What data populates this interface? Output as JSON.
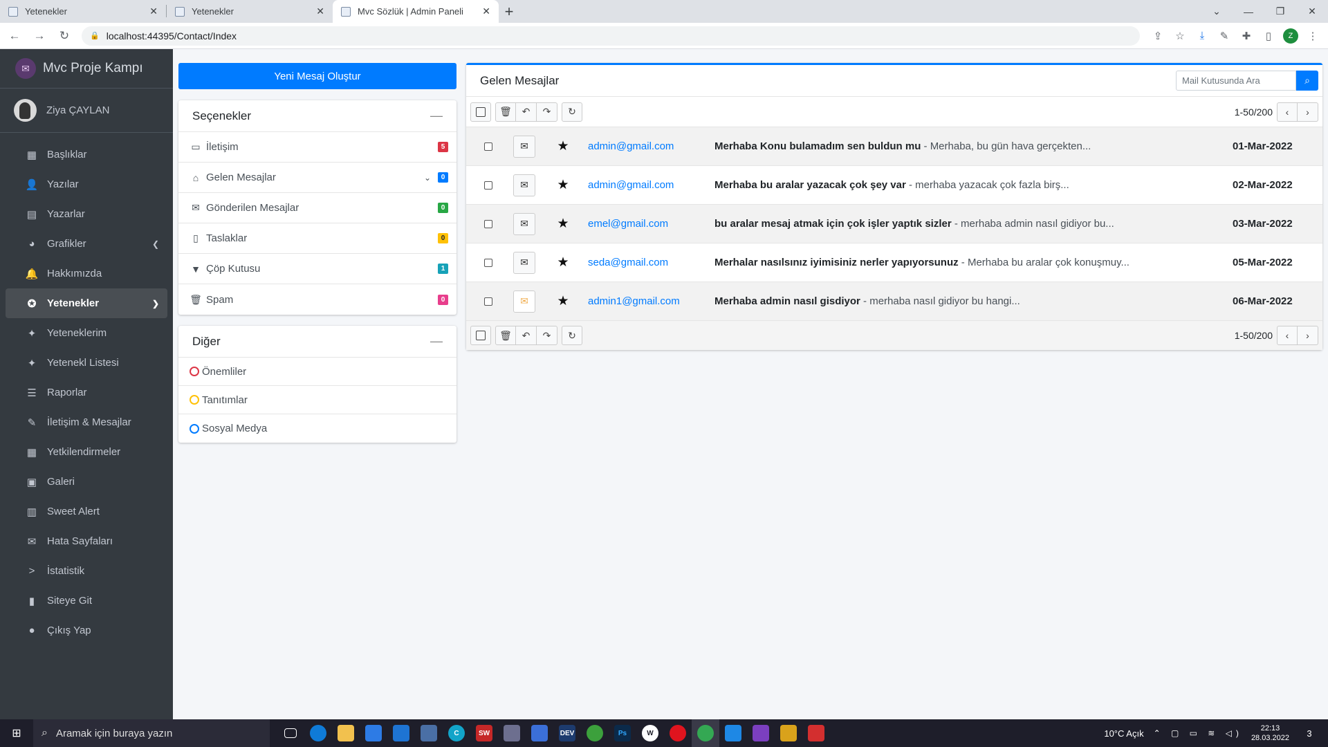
{
  "browser": {
    "tabs": [
      {
        "title": "Yetenekler",
        "active": false
      },
      {
        "title": "Yetenekler",
        "active": false
      },
      {
        "title": "Mvc Sözlük | Admin Paneli",
        "active": true
      }
    ],
    "url": "localhost:44395/Contact/Index",
    "profile_initial": "Z"
  },
  "sidebar": {
    "brand": "Mvc Proje Kampı",
    "user": "Ziya ÇAYLAN",
    "items": [
      {
        "label": "Başlıklar",
        "icon": "th-icon"
      },
      {
        "label": "Yazılar",
        "icon": "user-tie-icon"
      },
      {
        "label": "Yazarlar",
        "icon": "book-icon"
      },
      {
        "label": "Grafikler",
        "icon": "chart-pie-icon"
      },
      {
        "label": "Hakkımızda",
        "icon": "bell-icon"
      },
      {
        "label": "Yetenekler",
        "icon": "award-icon"
      },
      {
        "label": "Yeteneklerim",
        "icon": "puzzle-icon"
      },
      {
        "label": "Yetenekl Listesi",
        "icon": "puzzle-icon"
      },
      {
        "label": "Raporlar",
        "icon": "bars-icon"
      },
      {
        "label": "İletişim & Mesajlar",
        "icon": "edit-icon"
      },
      {
        "label": "Yetkilendirmeler",
        "icon": "calendar-icon"
      },
      {
        "label": "Galeri",
        "icon": "image-icon"
      },
      {
        "label": "Sweet Alert",
        "icon": "book-open-icon"
      },
      {
        "label": "Hata Sayfaları",
        "icon": "envelope-icon"
      },
      {
        "label": "İstatistik",
        "icon": "chevron-right-icon"
      },
      {
        "label": "Siteye Git",
        "icon": "file-icon"
      },
      {
        "label": "Çıkış Yap",
        "icon": "apple-icon"
      }
    ]
  },
  "compose_label": "Yeni Mesaj Oluştur",
  "folders": {
    "title": "Seçenekler",
    "items": [
      {
        "label": "İletişim",
        "count": "5",
        "color": "#dc3545",
        "icon": "address-card-icon"
      },
      {
        "label": "Gelen Mesajlar",
        "count": "0",
        "color": "#007bff",
        "icon": "inbox-icon"
      },
      {
        "label": "Gönderilen Mesajlar",
        "count": "0",
        "color": "#28a745",
        "icon": "envelope-icon"
      },
      {
        "label": "Taslaklar",
        "count": "0",
        "color": "#ffc107",
        "icon": "file-icon"
      },
      {
        "label": "Çöp Kutusu",
        "count": "1",
        "color": "#17a2b8",
        "icon": "filter-icon"
      },
      {
        "label": "Spam",
        "count": "0",
        "color": "#e83e8c",
        "icon": "trash-icon"
      }
    ]
  },
  "labels": {
    "title": "Diğer",
    "items": [
      {
        "label": "Önemliler",
        "color": "#dc3545"
      },
      {
        "label": "Tanıtımlar",
        "color": "#ffc107"
      },
      {
        "label": "Sosyal Medya",
        "color": "#007bff"
      }
    ]
  },
  "inbox": {
    "title": "Gelen Mesajlar",
    "search_placeholder": "Mail Kutusunda Ara",
    "pager": "1-50/200",
    "messages": [
      {
        "from": "admin@gmail.com",
        "subject": "Merhaba Konu bulamadım sen buldun mu",
        "preview": " - Merhaba, bu gün hava gerçekten...",
        "date": "01-Mar-2022",
        "type": "envelope-open-icon"
      },
      {
        "from": "admin@gmail.com",
        "subject": "Merhaba bu aralar yazacak çok şey var",
        "preview": " - merhaba yazacak çok fazla birş...",
        "date": "02-Mar-2022",
        "type": "envelope-open-icon"
      },
      {
        "from": "emel@gmail.com",
        "subject": "bu aralar mesaj atmak için çok işler yaptık sizler",
        "preview": " - merhaba admin nasıl gidiyor bu...",
        "date": "03-Mar-2022",
        "type": "envelope-open-icon"
      },
      {
        "from": "seda@gmail.com",
        "subject": "Merhalar nasılsınız iyimisiniz nerler yapıyorsunuz",
        "preview": " - Merhaba bu aralar çok konuşmuy...",
        "date": "05-Mar-2022",
        "type": "envelope-open-icon"
      },
      {
        "from": "admin1@gmail.com",
        "subject": "Merhaba admin nasıl gisdiyor",
        "preview": " - merhaba nasıl gidiyor bu hangi...",
        "date": "06-Mar-2022",
        "type": "envelope-warning-icon"
      }
    ]
  },
  "taskbar": {
    "search_placeholder": "Aramak için buraya yazın",
    "weather": "10°C  Açık",
    "time": "22:13",
    "date": "28.03.2022",
    "notification_count": "3"
  }
}
